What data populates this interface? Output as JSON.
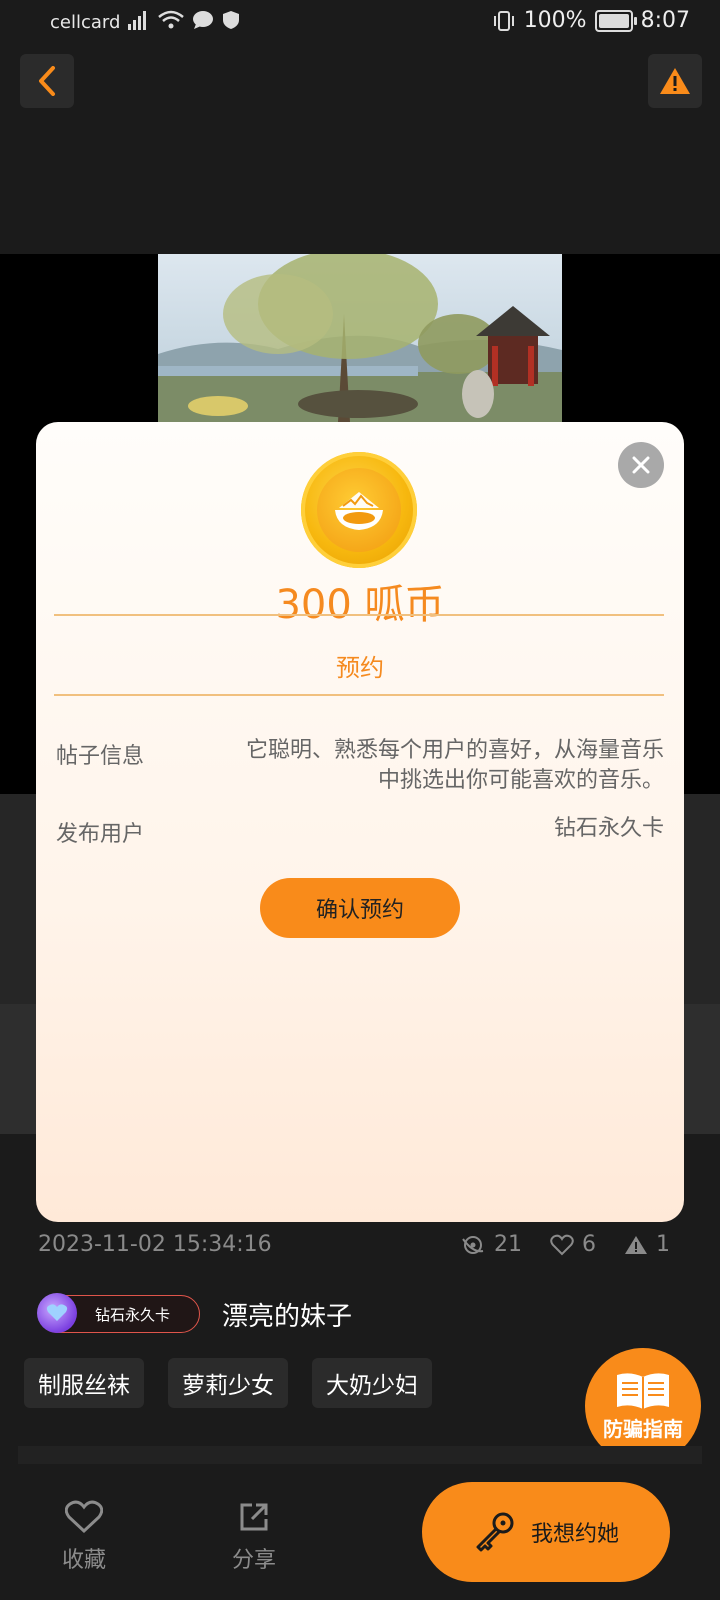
{
  "status_bar": {
    "carrier": "cellcard",
    "battery": "100%",
    "time": "8:07",
    "battery_level": 1.0
  },
  "meta": {
    "date": "2023-11-02 15:34:16",
    "views": "21",
    "likes": "6",
    "reports": "1"
  },
  "user": {
    "vip_badge": "钻石永久卡",
    "name": "漂亮的妹子"
  },
  "tags": [
    "制服丝袜",
    "萝莉少女",
    "大奶少妇"
  ],
  "guide": {
    "label": "防骗指南"
  },
  "bottom_bar": {
    "favorite": "收藏",
    "share": "分享",
    "date_button": "我想约她"
  },
  "modal": {
    "amount": "300 呱币",
    "title": "预约",
    "post_info_label": "帖子信息",
    "post_info_value": "它聪明、熟悉每个用户的喜好，从海量音乐中挑选出你可能喜欢的音乐。",
    "publisher_label": "发布用户",
    "publisher_value": "钻石永久卡",
    "confirm": "确认预约"
  },
  "colors": {
    "accent": "#f98b1a",
    "background": "#1b1b1b"
  }
}
